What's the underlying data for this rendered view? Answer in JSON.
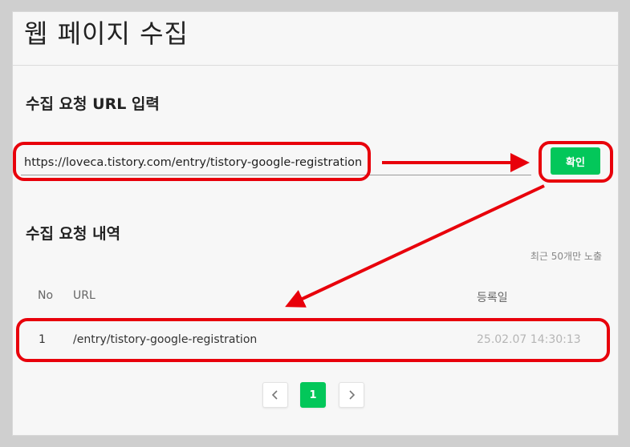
{
  "page": {
    "title": "웹 페이지 수집"
  },
  "request": {
    "section_title": "수집 요청 URL 입력",
    "url_value": "https://loveca.tistory.com/entry/tistory-google-registration",
    "confirm_label": "확인"
  },
  "history": {
    "section_title": "수집 요청 내역",
    "note": "최근 50개만 노출",
    "columns": {
      "no": "No",
      "url": "URL",
      "date": "등록일"
    },
    "rows": [
      {
        "no": "1",
        "url": "/entry/tistory-google-registration",
        "date": "25.02.07 14:30:13"
      }
    ]
  },
  "pagination": {
    "prev_icon": "chevron-left-icon",
    "current": "1",
    "next_icon": "chevron-right-icon"
  },
  "annotation_color": "#e8000b",
  "accent_color": "#03c75a"
}
